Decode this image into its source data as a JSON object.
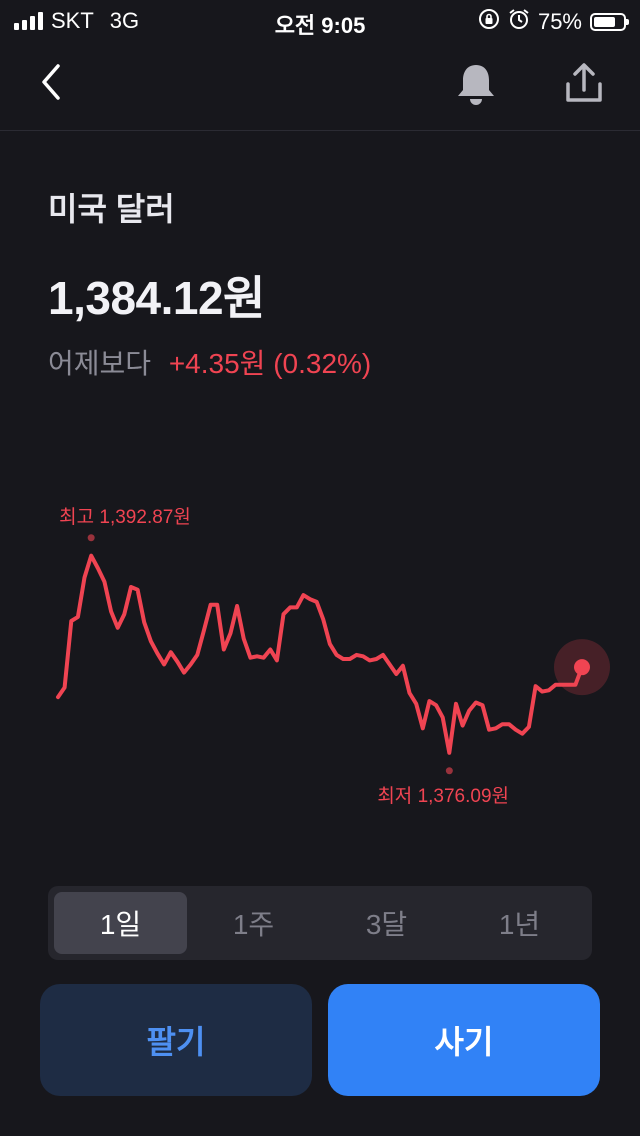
{
  "status": {
    "carrier": "SKT",
    "network": "3G",
    "time": "오전 9:05",
    "battery": "75%",
    "battery_level": 0.75
  },
  "header": {
    "back_icon": "chevron-left-icon",
    "bell_icon": "bell-icon",
    "share_icon": "share-icon"
  },
  "asset": {
    "name": "미국 달러",
    "price": "1,384.12원",
    "change_label": "어제보다",
    "change_value": "+4.35원 (0.32%)"
  },
  "colors": {
    "up": "#f04452",
    "accent": "#3182f6",
    "background": "#17171c"
  },
  "chart_data": {
    "type": "line",
    "high_label": "최고 1,392.87원",
    "low_label": "최저 1,376.09원",
    "high": 1392.87,
    "low": 1376.09,
    "last": 1384.12,
    "values": [
      1381.9,
      1382.6,
      1387.5,
      1387.8,
      1390.7,
      1392.3,
      1391.4,
      1390.4,
      1388.2,
      1387.0,
      1388.0,
      1390.0,
      1389.8,
      1387.4,
      1386.0,
      1385.1,
      1384.3,
      1385.2,
      1384.5,
      1383.7,
      1384.3,
      1385.0,
      1386.8,
      1388.7,
      1388.7,
      1385.4,
      1386.6,
      1388.6,
      1386.2,
      1384.8,
      1384.9,
      1384.8,
      1385.4,
      1384.6,
      1388.0,
      1388.5,
      1388.5,
      1389.4,
      1389.1,
      1388.9,
      1387.6,
      1385.8,
      1385.0,
      1384.7,
      1384.7,
      1385.0,
      1384.9,
      1384.6,
      1384.7,
      1385.0,
      1384.3,
      1383.6,
      1384.2,
      1382.2,
      1381.4,
      1379.6,
      1381.6,
      1381.3,
      1380.4,
      1377.8,
      1381.4,
      1379.8,
      1380.9,
      1381.5,
      1381.3,
      1379.5,
      1379.6,
      1379.9,
      1379.9,
      1379.5,
      1379.2,
      1379.7,
      1382.7,
      1382.3,
      1382.4,
      1382.8,
      1382.8,
      1382.8,
      1382.8,
      1384.1
    ]
  },
  "periods": [
    "1일",
    "1주",
    "3달",
    "1년"
  ],
  "active_period": 0,
  "actions": {
    "sell": "팔기",
    "buy": "사기"
  }
}
